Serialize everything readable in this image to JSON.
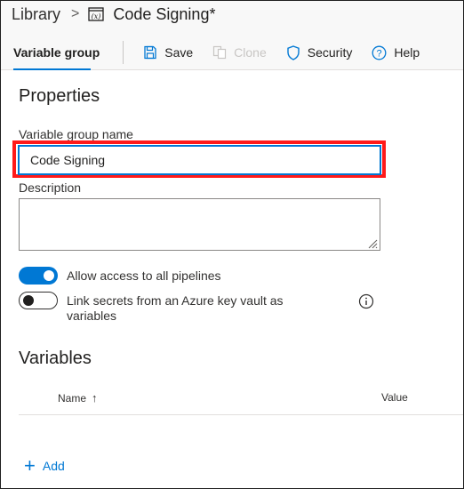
{
  "breadcrumb": {
    "library": "Library",
    "separator": ">",
    "icon": "variable-group-icon",
    "title": "Code Signing*"
  },
  "toolbar": {
    "tab_label": "Variable group",
    "save_label": "Save",
    "clone_label": "Clone",
    "security_label": "Security",
    "help_label": "Help"
  },
  "properties": {
    "heading": "Properties",
    "name_label": "Variable group name",
    "name_value": "Code Signing",
    "description_label": "Description",
    "description_value": "",
    "allow_access_label": "Allow access to all pipelines",
    "allow_access_on": true,
    "link_secrets_label_line1": "Link secrets from an Azure key vault as",
    "link_secrets_label_line2": "variables",
    "link_secrets_on": false
  },
  "variables": {
    "heading": "Variables",
    "col_name": "Name",
    "sort_arrow": "↑",
    "col_value": "Value",
    "add_label": "Add"
  },
  "colors": {
    "accent": "#0078d4",
    "highlight": "#ff1a1a"
  }
}
